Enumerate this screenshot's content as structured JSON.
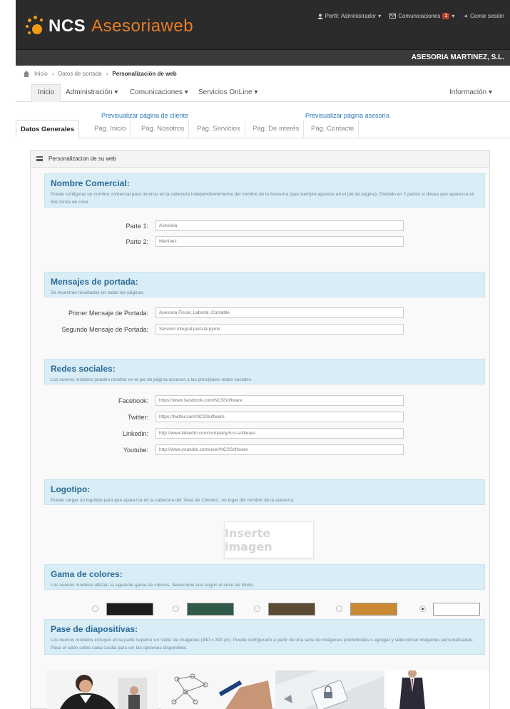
{
  "brand": {
    "ncs": "NCS",
    "name": "Asesoriaweb",
    "accent": "#e67e22"
  },
  "top_links": {
    "profile": "Perfil: Administrador",
    "communications": "Comunicaciones",
    "comm_count": "1",
    "logout": "Cerrar sesión"
  },
  "company": "ASESORIA MARTINEZ, S.L.",
  "breadcrumb": {
    "home": "Inicio",
    "portal": "Datos de portada",
    "current": "Personalización de web"
  },
  "nav": {
    "inicio": "Inicio",
    "administracion": "Administración",
    "comunicaciones": "Comunicaciones",
    "servicios": "Servicios OnLine",
    "informacion": "Información"
  },
  "preview": {
    "client": "Previsualizar página de cliente",
    "asesoria": "Previsualizar página asesoría"
  },
  "tabs": [
    "Datos Generales",
    "Pág. Inicio",
    "Pág. Nosotros",
    "Pág. Servicios",
    "Pág. De interés",
    "Pág. Contacte"
  ],
  "card_title": "Personalizacion de su web",
  "sections": {
    "nombre": {
      "title": "Nombre Comercial:",
      "desc": "Puede configurar un nombre comercial para mostrar en la cabecera independientemente del nombre de la Asesoría (que siempre aparece en el pie de página). Dividalo en 2 partes si desea que aparezca en dos tonos de color",
      "part1_label": "Parte 1:",
      "part1_value": "Asesoria",
      "part2_label": "Parte 2:",
      "part2_value": "Martinez"
    },
    "mensajes": {
      "title": "Mensajes de portada:",
      "desc": "Se muestran resaltados en todas las páginas",
      "primer_label": "Primer Mensaje de Portada:",
      "primer_value": "Asesoria Fiscal, Laboral, Contable",
      "segundo_label": "Segundo Mensaje de Portada:",
      "segundo_value": "Servicio integral para la pyme"
    },
    "redes": {
      "title": "Redes sociales:",
      "desc": "Los nuevos modelos pueden mostrar en el pie de página accesos a las principales redes sociales.",
      "facebook_label": "Facebook:",
      "facebook_value": "https://www.facebook.com/NCSSoftware",
      "twitter_label": "Twitter:",
      "twitter_value": "https://twitter.com/NCSSoftware",
      "linkedin_label": "Linkedin:",
      "linkedin_value": "http://www.linkedin.com/company/ncs-software",
      "youtube_label": "Youtube:",
      "youtube_value": "http://www.youtube.com/user/NCSSoftware"
    },
    "logotipo": {
      "title": "Logotipo:",
      "desc": "Puede cargar un logotipo para que aparezca en la cabecera del 'Área de Clientes', en lugar del nombre de la asesoría.",
      "placeholder": "Inserte imagen"
    },
    "gama": {
      "title": "Gama de colores:",
      "desc": "Los nuevos modelos utilizan la siguiente gama de colores. Seleccione uno según el color de fondo.",
      "colors": [
        "#1c1c1c",
        "#2f5a47",
        "#5b4a34",
        "#c98a33",
        "#ffffff"
      ],
      "selected": 4
    },
    "pase": {
      "title": "Pase de diapositivas:",
      "desc": "Los nuevos modelos incluyen en la parte superior un 'slide' de imágenes (940 x 300 px). Puede configurarlo a partir de una serie de imágenes predefinidas o agregar y seleccionar imágenes personalizadas. Pase el ratón sobre cada casilla para ver las opciones disponibles."
    }
  }
}
